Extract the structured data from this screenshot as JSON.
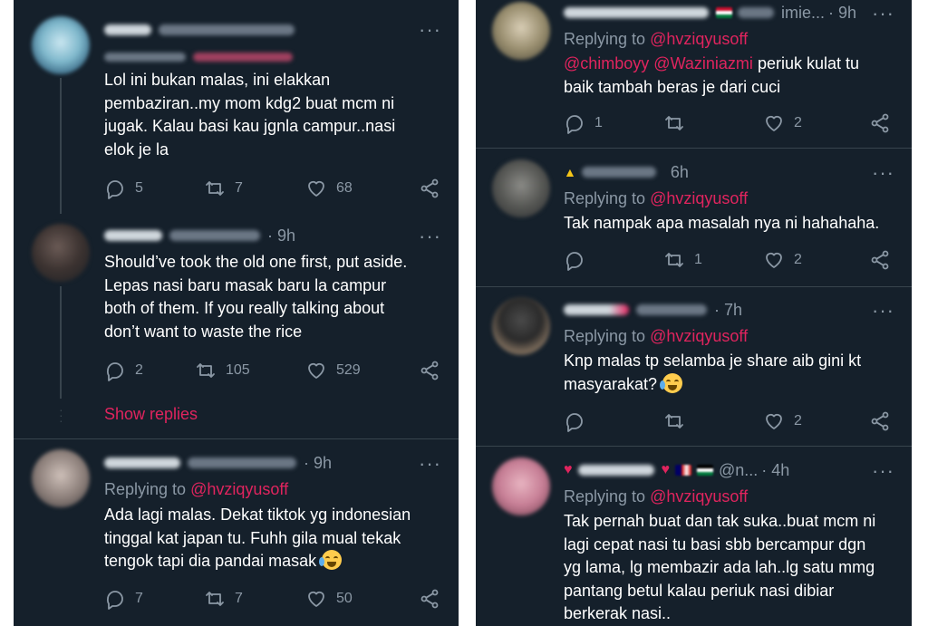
{
  "left": {
    "tweets": [
      {
        "header_time": "",
        "replying_label": "Replying to",
        "replying_handle": "",
        "body": "Lol ini bukan malas, ini elakkan\npembaziran..my mom kdg2 buat mcm ni\njugak. Kalau basi kau jgnla campur..nasi\nelok je la",
        "replies": "5",
        "retweets": "7",
        "likes": "68"
      },
      {
        "header_time": "· 9h",
        "body": "Should’ve took the old one first, put aside.\nLepas nasi baru masak baru la campur\nboth of them. If you really talking about\ndon’t want to waste the rice",
        "replies": "2",
        "retweets": "105",
        "likes": "529"
      },
      {
        "header_time": "· 9h",
        "replying_label": "Replying to",
        "replying_handle": "@hvziqyusoff",
        "body": "Ada lagi malas. Dekat tiktok yg indonesian\ntinggal kat japan tu. Fuhh gila mual tekak\ntengok tapi dia pandai masak",
        "replies": "7",
        "retweets": "7",
        "likes": "50"
      }
    ],
    "show_replies": "Show replies"
  },
  "right": {
    "tweets": [
      {
        "header_tail": "imie...",
        "header_time": "· 9h",
        "replying_label": "Replying to",
        "replying_handle": "@hvziqyusoff",
        "mentions": "@chimboyy @Waziniazmi",
        "body": "periuk kulat tu\nbaik tambah beras je dari cuci",
        "replies": "1",
        "likes": "2"
      },
      {
        "header_time": "6h",
        "replying_label": "Replying to",
        "replying_handle": "@hvziqyusoff",
        "body": "Tak nampak apa masalah nya ni hahahaha.",
        "retweets": "1",
        "likes": "2"
      },
      {
        "header_time": "· 7h",
        "replying_label": "Replying to",
        "replying_handle": "@hvziqyusoff",
        "body": "Knp malas tp selamba je share aib gini kt\nmasyarakat?",
        "likes": "2"
      },
      {
        "header_tail": "@n...",
        "header_time": "· 4h",
        "replying_label": "Replying to",
        "replying_handle": "@hvziqyusoff",
        "body": "Tak pernah buat dan tak suka..buat mcm ni\nlagi cepat nasi tu basi sbb bercampur dgn\nyg lama, lg membazir ada lah..lg satu mmg\npantang betul kalau periuk nasi dibiar\nberkerak nasi.."
      }
    ]
  },
  "colors": {
    "background": "#15202b",
    "divider": "#38444d",
    "text_primary": "#ffffff",
    "text_secondary": "#8b98a5",
    "accent": "#e0245e"
  },
  "icons": [
    "reply-icon",
    "retweet-icon",
    "like-icon",
    "share-icon",
    "more-icon"
  ]
}
